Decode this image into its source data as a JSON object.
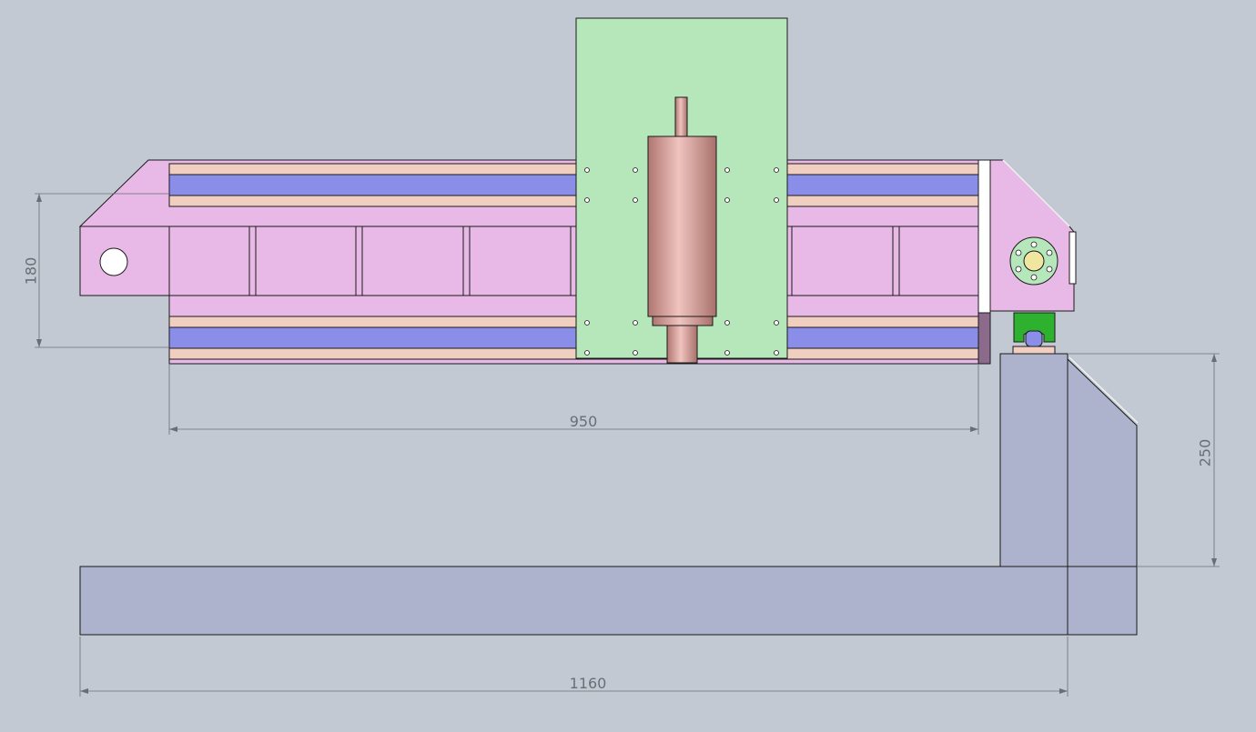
{
  "drawing": {
    "background_color": "#c3c9d3",
    "colors": {
      "gantry_beam": "#e8b9e6",
      "rail_strip": "#f0cfc0",
      "rail_track": "#8a8ee8",
      "carriage_plate": "#b6e7bb",
      "spindle": "#d49590",
      "base_frame": "#adb2cd",
      "guide_block": "#2db12e",
      "dimension_line": "#6a6e74",
      "outline": "#1a1a1a"
    },
    "dimensions": {
      "gantry_width": "950",
      "gantry_height": "180",
      "column_height": "250",
      "base_length": "1160"
    }
  }
}
